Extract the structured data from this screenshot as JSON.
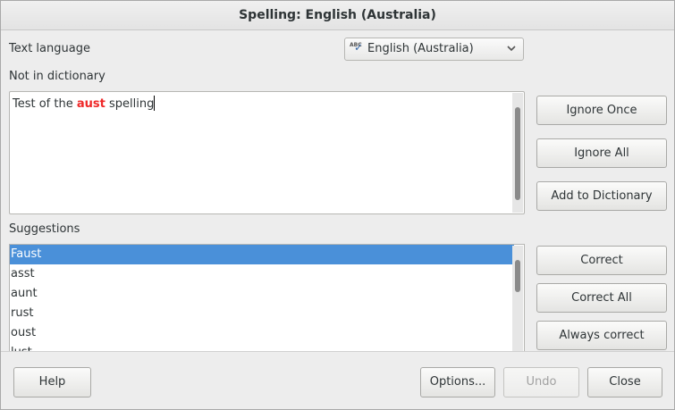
{
  "window": {
    "title": "Spelling: English (Australia)"
  },
  "language": {
    "label": "Text language",
    "selected": "English (Australia)",
    "icon": "spellcheck-icon"
  },
  "not_in_dictionary": {
    "label": "Not in dictionary",
    "text_before": "Test of the ",
    "error_word": "aust",
    "text_after": " spelling"
  },
  "suggestions": {
    "label": "Suggestions",
    "items": [
      "Faust",
      "asst",
      "aunt",
      "rust",
      "oust",
      "lust"
    ],
    "selected_index": 0
  },
  "actions": {
    "ignore_once": "Ignore Once",
    "ignore_all": "Ignore All",
    "add_to_dictionary": "Add to Dictionary",
    "correct": "Correct",
    "correct_all": "Correct All",
    "always_correct": "Always correct"
  },
  "footer": {
    "help": "Help",
    "options": "Options...",
    "undo": "Undo",
    "close": "Close"
  },
  "colors": {
    "selection": "#4a90d9",
    "error_word": "#ef2929"
  }
}
